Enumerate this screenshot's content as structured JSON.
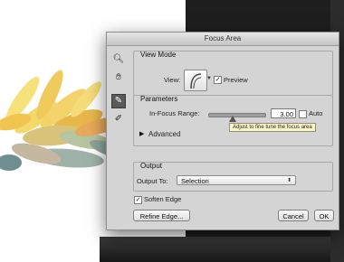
{
  "dialog": {
    "title": "Focus Area"
  },
  "tools": [
    "zoom-icon",
    "hand-icon",
    "focus-area-add-brush-icon",
    "focus-area-subtract-brush-icon"
  ],
  "view_mode": {
    "section_title": "View Mode",
    "view_label": "View:",
    "preview_label": "Preview",
    "preview_checked": true
  },
  "parameters": {
    "section_title": "Parameters",
    "in_focus_range_label": "In-Focus Range:",
    "in_focus_range_value": "3.00",
    "slider_fraction": 0.42,
    "auto_label": "Auto",
    "auto_checked": false,
    "tooltip": "Adjust to fine tune the focus area",
    "advanced_label": "Advanced"
  },
  "output": {
    "section_title": "Output",
    "output_to_label": "Output To:",
    "output_to_value": "Selection"
  },
  "soften_edge": {
    "label": "Soften Edge",
    "checked": true
  },
  "buttons": {
    "refine_edge": "Refine Edge...",
    "cancel": "Cancel",
    "ok": "OK"
  }
}
